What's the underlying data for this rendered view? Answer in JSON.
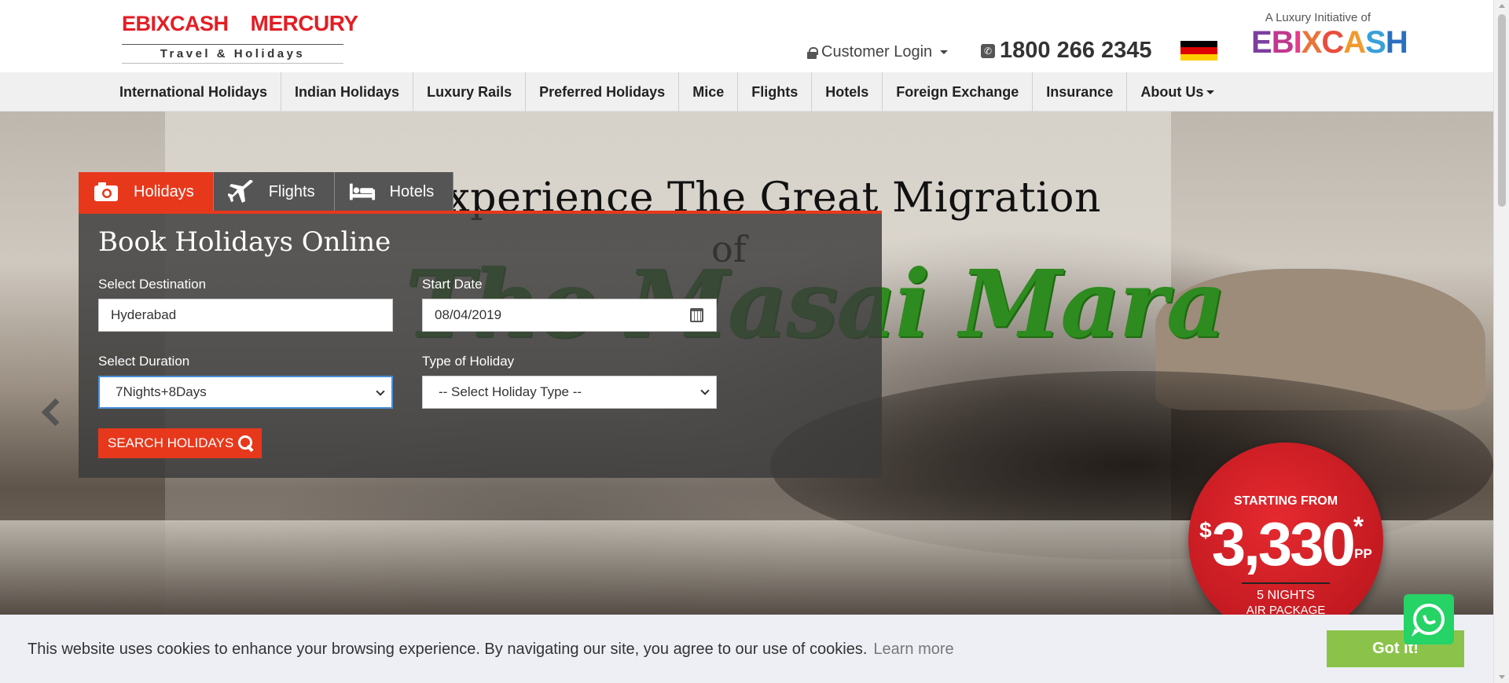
{
  "header": {
    "logo": {
      "brand_left": "EBIXCASH",
      "brand_right": "MERCURY",
      "tagline": "Travel & Holidays"
    },
    "customer_login": "Customer Login",
    "phone_number": "1800 266 2345",
    "flag": {
      "name": "germany-flag",
      "colors": [
        "#000000",
        "#dd0000",
        "#ffce00"
      ]
    },
    "luxury": {
      "text": "A Luxury Initiative of",
      "brand": "EBIXCASH"
    }
  },
  "nav": {
    "items": [
      "International Holidays",
      "Indian Holidays",
      "Luxury Rails",
      "Preferred Holidays",
      "Mice",
      "Flights",
      "Hotels",
      "Foreign Exchange",
      "Insurance",
      "About Us"
    ]
  },
  "hero": {
    "headline": "Experience The Great Migration",
    "headline_of": "of",
    "headline_place": "The Masai Mara",
    "badge": {
      "starting": "STARTING FROM",
      "currency": "$",
      "amount": "3,330",
      "asterisk": "*",
      "unit": "PP",
      "nights": "5 NIGHTS",
      "package": "AIR PACKAGE"
    }
  },
  "search": {
    "tabs": [
      {
        "label": "Holidays",
        "icon": "camera-icon",
        "active": true
      },
      {
        "label": "Flights",
        "icon": "plane-icon",
        "active": false
      },
      {
        "label": "Hotels",
        "icon": "bed-icon",
        "active": false
      }
    ],
    "title": "Book Holidays Online",
    "destination": {
      "label": "Select Destination",
      "value": "Hyderabad"
    },
    "start_date": {
      "label": "Start Date",
      "value": "08/04/2019"
    },
    "duration": {
      "label": "Select Duration",
      "value": "7Nights+8Days"
    },
    "holiday_type": {
      "label": "Type of Holiday",
      "value": "-- Select Holiday Type --"
    },
    "button": "SEARCH HOLIDAYS"
  },
  "cookie": {
    "text": "This website uses cookies to enhance your browsing experience. By navigating our site, you agree to our use of cookies.",
    "link": "Learn more",
    "button": "Got it!"
  },
  "colors": {
    "brand_red": "#e8381c",
    "nav_bg": "#f0f0f0",
    "accept_green": "#8bc34a",
    "whatsapp_green": "#25d366"
  }
}
